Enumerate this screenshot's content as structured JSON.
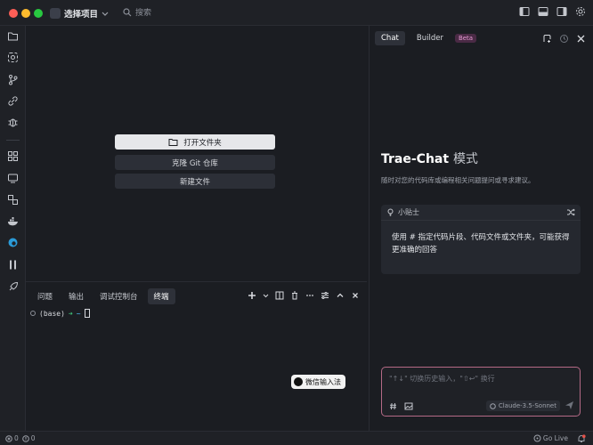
{
  "titlebar": {
    "project_name": "选择项目",
    "search_placeholder": "搜索"
  },
  "welcome": {
    "open_folder": "打开文件夹",
    "clone_git": "克隆 Git 仓库",
    "new_file": "新建文件"
  },
  "panel": {
    "tabs": [
      {
        "label": "问题"
      },
      {
        "label": "输出"
      },
      {
        "label": "调试控制台"
      },
      {
        "label": "终端"
      }
    ],
    "active_tab": "终端",
    "terminal": {
      "env": "(base)",
      "arrow": "➜",
      "cwd": "~"
    },
    "ime_label": "微信输入法"
  },
  "chat": {
    "tabs": {
      "chat": "Chat",
      "builder": "Builder",
      "beta": "Beta"
    },
    "title_main": "Trae-Chat",
    "title_sub": "模式",
    "description": "随时对您的代码库或编程相关问题提问或寻求建议。",
    "tip": {
      "header": "小贴士",
      "body": "使用 # 指定代码片段、代码文件或文件夹，可能获得更准确的回答"
    },
    "input_placeholder": "\"↑↓\" 切换历史输入，\"⇧↩\" 换行",
    "model": "Claude-3.5-Sonnet"
  },
  "statusbar": {
    "errors": "0",
    "warnings": "0",
    "go_live": "Go Live"
  },
  "colors": {
    "background": "#1b1d22",
    "chrome": "#1f2126",
    "primary_button": "#e6e7ea",
    "dark_button": "#2c2f37",
    "accent_pink": "#b46a86",
    "beta_badge": "#e59ad2",
    "terminal_green": "#3fc37a",
    "notification_red": "#e5534b"
  }
}
